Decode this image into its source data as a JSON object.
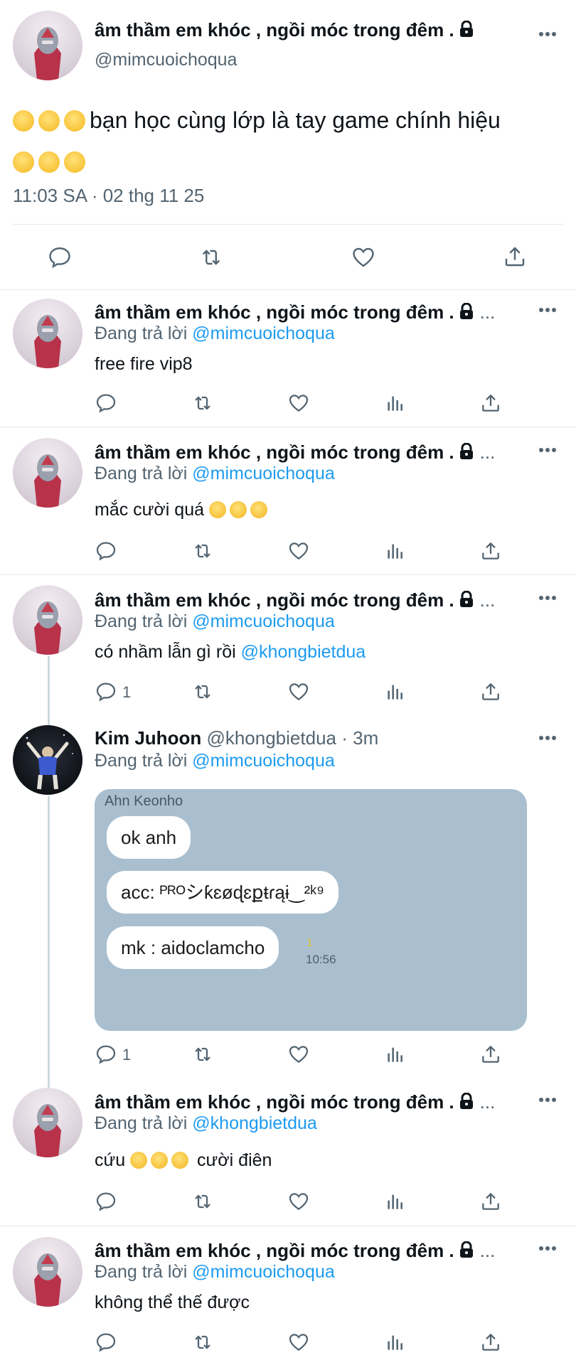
{
  "main_tweet": {
    "author_name": "âm thầm em khóc , ngồi móc trong đêm .",
    "author_handle": "@mimcuoichoqua",
    "text": "bạn học cùng lớp là tay game chính hiệu",
    "timestamp": "11:03 SA · 02 thg 11 25"
  },
  "replies": [
    {
      "author_name": "âm thầm em khóc , ngồi móc trong đêm .",
      "ellipsis": "...",
      "replying_label": "Đang trả lời",
      "replying_to": "@mimcuoichoqua",
      "text": "free fire vip8"
    },
    {
      "author_name": "âm thầm em khóc , ngồi móc trong đêm .",
      "ellipsis": "...",
      "replying_label": "Đang trả lời",
      "replying_to": "@mimcuoichoqua",
      "text": "mắc cười quá"
    },
    {
      "author_name": "âm thầm em khóc , ngồi móc trong đêm .",
      "ellipsis": "...",
      "replying_label": "Đang trả lời",
      "replying_to": "@mimcuoichoqua",
      "text": "có nhầm lẫn gì rồi",
      "mention": "@khongbietdua",
      "reply_count": "1"
    },
    {
      "author_name": "Kim Juhoon",
      "author_handle": "@khongbietdua",
      "time_ago": "· 3m",
      "replying_label": "Đang trả lời",
      "replying_to": "@mimcuoichoqua",
      "reply_count": "1",
      "chat": {
        "sender": "Ahn Keonho",
        "msg1": "ok anh",
        "msg2": "acc: ᴾᴿᴼシƙɛøɖɛքŧɾąɨ‿²ᵏ⁹",
        "msg3": "mk : aidoclamcho",
        "read_mark": "1",
        "time": "10:56"
      }
    },
    {
      "author_name": "âm thầm em khóc , ngồi móc trong đêm .",
      "ellipsis": "...",
      "replying_label": "Đang trả lời",
      "replying_to": "@khongbietdua",
      "text": "cứu",
      "text_after": "cười điên"
    },
    {
      "author_name": "âm thầm em khóc , ngồi móc trong đêm .",
      "ellipsis": "...",
      "replying_label": "Đang trả lời",
      "replying_to": "@mimcuoichoqua",
      "text": "không thể thế được"
    }
  ],
  "icons": [
    "reply-icon",
    "retweet-icon",
    "like-icon",
    "views-icon",
    "share-icon",
    "more-icon",
    "lock-icon"
  ],
  "colors": {
    "accent": "#1d9bf0",
    "secondary_text": "#536471",
    "chat_bg": "#a9bfcf"
  }
}
